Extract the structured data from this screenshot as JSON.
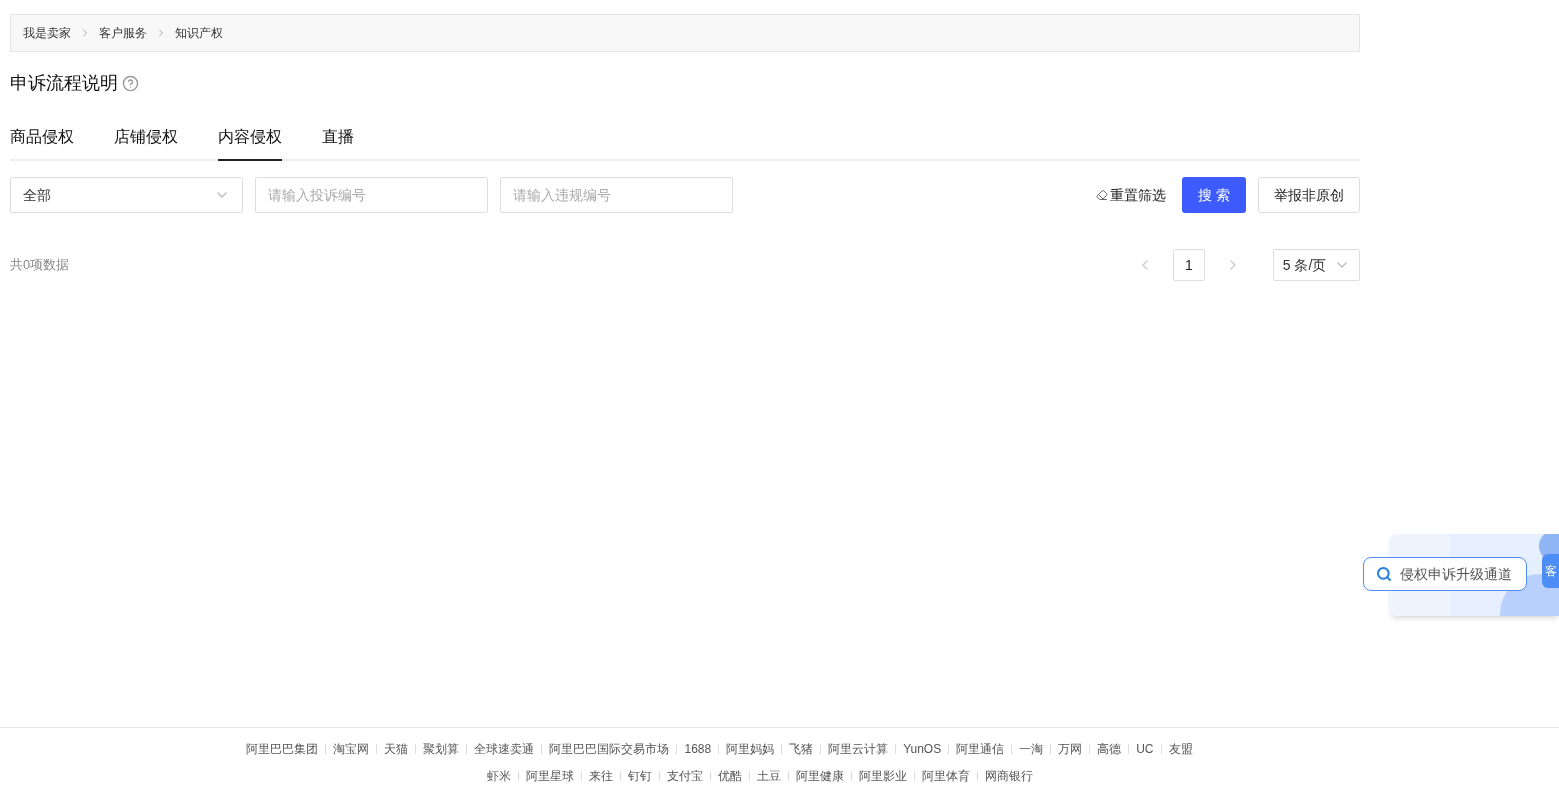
{
  "breadcrumb": [
    "我是卖家",
    "客户服务",
    "知识产权"
  ],
  "heading": {
    "title": "申诉流程说明"
  },
  "tabs": [
    {
      "label": "商品侵权",
      "selected": false
    },
    {
      "label": "店铺侵权",
      "selected": false
    },
    {
      "label": "内容侵权",
      "selected": true
    },
    {
      "label": "直播",
      "selected": false
    }
  ],
  "filters": {
    "type_select": "全部",
    "complaint_no": {
      "placeholder": "请输入投诉编号"
    },
    "violation_no": {
      "placeholder": "请输入违规编号"
    },
    "reset": "重置筛选",
    "search": "搜 索",
    "report": "举报非原创"
  },
  "results": {
    "total": "共0项数据",
    "pagination": {
      "page": "1",
      "page_size": "5 条/页"
    }
  },
  "floating_widget": {
    "search_label": "侵权申诉升级通道",
    "side_tab": "客"
  },
  "footer": {
    "top_links": [
      "阿里巴巴集团",
      "淘宝网",
      "天猫",
      "聚划算",
      "全球速卖通",
      "阿里巴巴国际交易市场",
      "1688",
      "阿里妈妈",
      "飞猪",
      "阿里云计算",
      "YunOS",
      "阿里通信",
      "一淘",
      "万网",
      "高德",
      "UC",
      "友盟"
    ],
    "bottom_links": [
      "虾米",
      "阿里星球",
      "来往",
      "钉钉",
      "支付宝",
      "优酷",
      "土豆",
      "阿里健康",
      "阿里影业",
      "阿里体育",
      "网商银行"
    ]
  }
}
